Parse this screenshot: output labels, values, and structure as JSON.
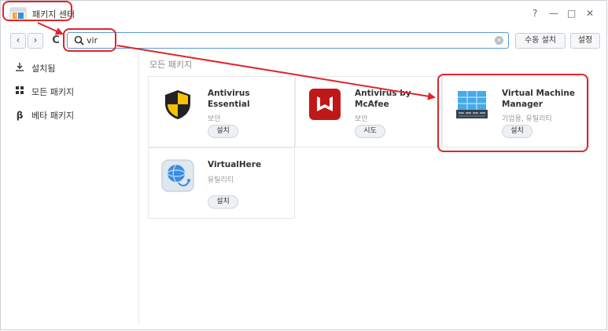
{
  "window": {
    "title": "패키지 센터",
    "help": "?",
    "minimize": "—",
    "maximize": "□",
    "close": "✕"
  },
  "toolbar": {
    "back": "‹",
    "forward": "›",
    "refresh": "C",
    "search_value": "vir",
    "manual_install": "수동 설치",
    "settings": "설정"
  },
  "sidebar": {
    "items": [
      {
        "label": "설치됨",
        "icon": "download-icon"
      },
      {
        "label": "모든 패키지",
        "icon": "grid-icon"
      },
      {
        "label": "베타 패키지",
        "icon": "beta-icon"
      }
    ]
  },
  "main": {
    "section_title": "모든 패키지",
    "packages": [
      {
        "name": "Antivirus Essential",
        "category": "보안",
        "action": "설치",
        "icon": "shield-icon"
      },
      {
        "name": "Antivirus by McAfee",
        "category": "보안",
        "action": "시도",
        "icon": "mcafee-icon"
      },
      {
        "name": "Virtual Machine Manager",
        "category": "기업용, 유틸리티",
        "action": "설치",
        "icon": "vmm-icon"
      },
      {
        "name": "VirtualHere",
        "category": "유틸리티",
        "action": "설치",
        "icon": "virtualhere-icon"
      }
    ]
  },
  "colors": {
    "annotation": "#e0242b",
    "search_border": "#5a9ad6"
  }
}
